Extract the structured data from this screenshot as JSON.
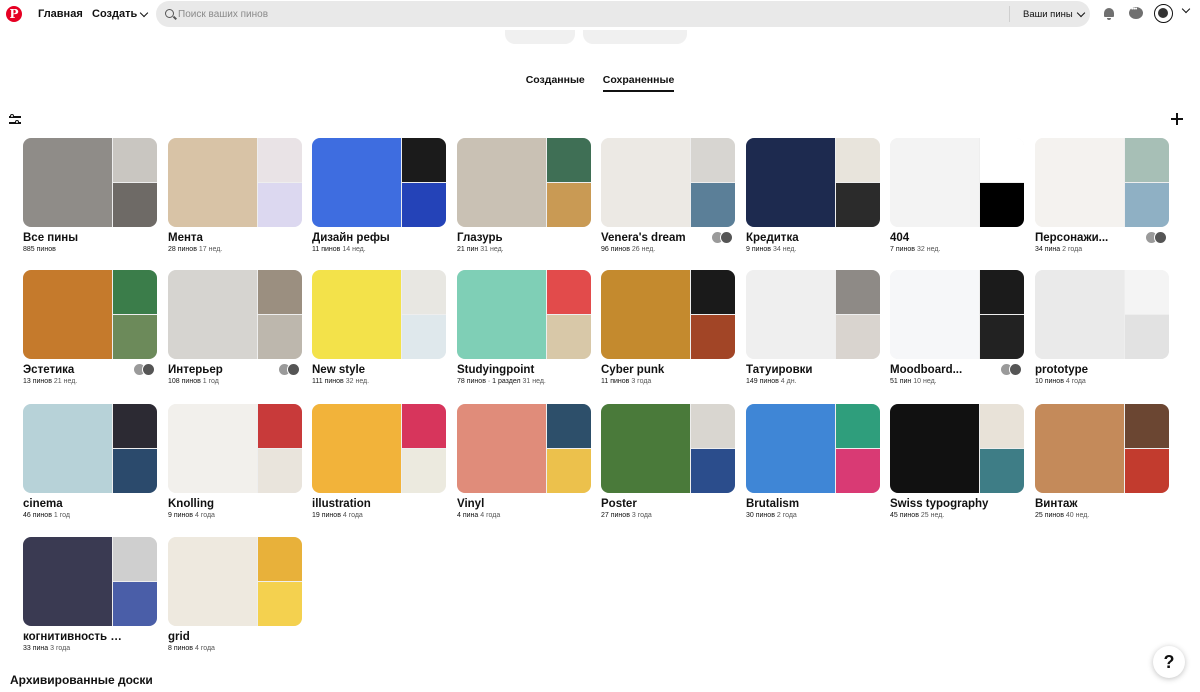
{
  "header": {
    "home_label": "Главная",
    "create_label": "Создать",
    "search_placeholder": "Поиск ваших пинов",
    "your_pins_label": "Ваши пины"
  },
  "tabs": [
    {
      "label": "Созданные",
      "active": false
    },
    {
      "label": "Сохраненные",
      "active": true
    }
  ],
  "colors": {
    "brand": "#e60023",
    "search_bg": "#e9e9e9"
  },
  "boards": [
    {
      "title": "Все пины",
      "count": "885 пинов",
      "age": "",
      "colors": [
        "#8f8c88",
        "#c9c6c1",
        "#6e6a66"
      ]
    },
    {
      "title": "Мента",
      "count": "28 пинов",
      "age": "17 нед.",
      "colors": [
        "#d8c3a6",
        "#e9e3e6",
        "#dcd8f0"
      ]
    },
    {
      "title": "Дизайн рефы",
      "count": "11 пинов",
      "age": "14 нед.",
      "colors": [
        "#3e6de0",
        "#1b1b1b",
        "#2443b8"
      ]
    },
    {
      "title": "Глазурь",
      "count": "21 пин",
      "age": "31 нед.",
      "colors": [
        "#c9c1b4",
        "#3f6f55",
        "#c99a54"
      ]
    },
    {
      "title": "Venera's dream",
      "count": "96 пинов",
      "age": "26 нед.",
      "colors": [
        "#ece9e4",
        "#d7d5d1",
        "#5b7f98"
      ]
    },
    {
      "title": "Кредитка",
      "count": "9 пинов",
      "age": "34 нед.",
      "colors": [
        "#1d2a4f",
        "#e8e4dc",
        "#2b2b2b"
      ]
    },
    {
      "title": "404",
      "count": "7 пинов",
      "age": "32 нед.",
      "colors": [
        "#f3f3f3",
        "#ffffff",
        "#000000"
      ]
    },
    {
      "title": "Персонажи...",
      "count": "34 пина",
      "age": "2 года",
      "colors": [
        "#f4f2ef",
        "#a7bfb6",
        "#8fb0c4"
      ]
    },
    {
      "title": "Эстетика",
      "count": "13 пинов",
      "age": "21 нед.",
      "colors": [
        "#c57a2c",
        "#3b7d4a",
        "#6c8a5a"
      ]
    },
    {
      "title": "Интерьер",
      "count": "108 пинов",
      "age": "1 год",
      "colors": [
        "#d6d4d0",
        "#9b8f80",
        "#bdb7ad"
      ]
    },
    {
      "title": "New style",
      "count": "111 пинов",
      "age": "32 нед.",
      "colors": [
        "#f3e24a",
        "#e8e7e2",
        "#dfe8ec"
      ]
    },
    {
      "title": "Studyingpoint",
      "count": "78 пинов · 1 раздел",
      "age": "31 нед.",
      "colors": [
        "#7fcfb6",
        "#e24b4b",
        "#d8c8a8"
      ]
    },
    {
      "title": "Cyber punk",
      "count": "11 пинов",
      "age": "3 года",
      "colors": [
        "#c48a2e",
        "#1a1a1a",
        "#a24526"
      ]
    },
    {
      "title": "Татуировки",
      "count": "149 пинов",
      "age": "4 дн.",
      "colors": [
        "#efefef",
        "#8e8a86",
        "#d9d4cf"
      ]
    },
    {
      "title": "Moodboard...",
      "count": "51 пин",
      "age": "10 нед.",
      "colors": [
        "#f6f7f9",
        "#1b1b1b",
        "#222222"
      ]
    },
    {
      "title": "prototype",
      "count": "10 пинов",
      "age": "4 года",
      "colors": [
        "#eaeaea",
        "#f4f4f4",
        "#e2e2e2"
      ]
    },
    {
      "title": "cinema",
      "count": "46 пинов",
      "age": "1 год",
      "colors": [
        "#b7d2d8",
        "#2c2a33",
        "#2b4a6c"
      ]
    },
    {
      "title": "Knolling",
      "count": "9 пинов",
      "age": "4 года",
      "colors": [
        "#f2f0ec",
        "#c83a3a",
        "#e9e4dc"
      ]
    },
    {
      "title": "illustration",
      "count": "19 пинов",
      "age": "4 года",
      "colors": [
        "#f2b33a",
        "#d7355c",
        "#eceadf"
      ]
    },
    {
      "title": "Vinyl",
      "count": "4 пина",
      "age": "4 года",
      "colors": [
        "#e08c7a",
        "#2d4f6a",
        "#ecc14c"
      ]
    },
    {
      "title": "Poster",
      "count": "27 пинов",
      "age": "3 года",
      "colors": [
        "#4a7a3a",
        "#d9d6d0",
        "#2b4d8c"
      ]
    },
    {
      "title": "Brutalism",
      "count": "30 пинов",
      "age": "2 года",
      "colors": [
        "#3f86d6",
        "#2f9e7c",
        "#d93a74"
      ]
    },
    {
      "title": "Swiss typography",
      "count": "45 пинов",
      "age": "25 нед.",
      "colors": [
        "#111111",
        "#e8e2d8",
        "#3e7d86"
      ]
    },
    {
      "title": "Винтаж",
      "count": "25 пинов",
      "age": "40 нед.",
      "colors": [
        "#c48a5a",
        "#6b4632",
        "#c23b2e"
      ]
    },
    {
      "title": "когнитивность бытия",
      "count": "33 пина",
      "age": "3 года",
      "colors": [
        "#3a3a52",
        "#cfcfcf",
        "#4a5ea8"
      ]
    },
    {
      "title": "grid",
      "count": "8 пинов",
      "age": "4 года",
      "colors": [
        "#eee9df",
        "#e8b13a",
        "#f4d14f"
      ]
    }
  ],
  "archived_label": "Архивированные доски",
  "help_label": "?"
}
